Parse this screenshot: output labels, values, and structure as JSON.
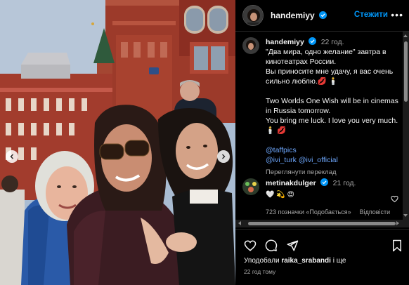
{
  "header": {
    "username": "handemiyy",
    "follow_label": "Стежити",
    "more_icon": "more-icon"
  },
  "caption": {
    "username": "handemiyy",
    "time": "22 год.",
    "ru_line1": "\"Два мира, одно желание\" завтра в кинотеатрах России.",
    "ru_line2": "Вы приносите мне удачу, я вас очень сильно люблю.💋 🕯️",
    "en_line1": "Two Worlds One Wish will be in cinemas in Russia tomorrow.",
    "en_line2": "You bring me luck. I love you very much. 🕯️ 💋",
    "tag1": "@taffpics",
    "tag2": "@ivi_turk",
    "tag3": "@ivi_official",
    "translate_label": "Переглянути переклад"
  },
  "comment": {
    "username": "metinakdulger",
    "time": "21 год.",
    "text": "🤍 💫 😍",
    "likes_label": "723 позначки «Подобається»",
    "reply_label": "Відповісти"
  },
  "footer": {
    "likes_prefix": "Уподобали ",
    "likes_user": "raika_srabandi",
    "likes_suffix": " і ще",
    "time": "22 год тому"
  },
  "colors": {
    "accent": "#0095f6",
    "verified": "#0095f6",
    "secondary_text": "#a8a8a8",
    "background": "#000000"
  }
}
